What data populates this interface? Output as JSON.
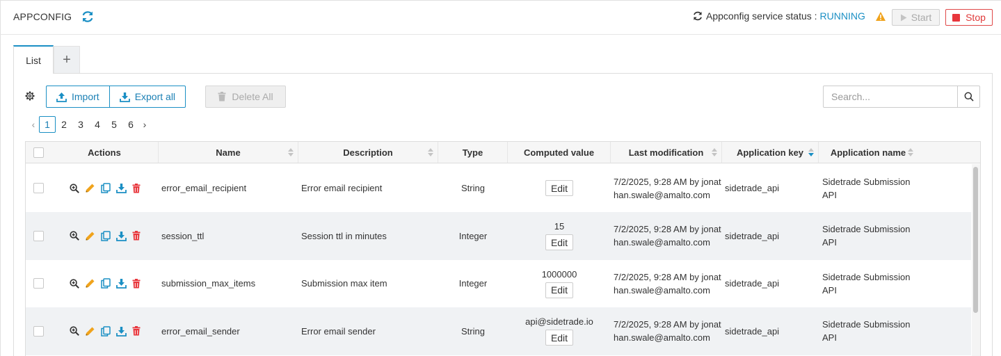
{
  "header": {
    "title": "APPCONFIG",
    "status_label": "Appconfig service status :",
    "status_value": "RUNNING",
    "start_label": "Start",
    "stop_label": "Stop"
  },
  "tabs": {
    "list_label": "List",
    "add_label": "+"
  },
  "toolbar": {
    "import_label": "Import",
    "export_label": "Export all",
    "delete_all_label": "Delete All",
    "search_placeholder": "Search..."
  },
  "pagination": {
    "prev": "‹",
    "next": "›",
    "pages": [
      "1",
      "2",
      "3",
      "4",
      "5",
      "6"
    ],
    "current": "1"
  },
  "table": {
    "columns": {
      "actions": "Actions",
      "name": "Name",
      "description": "Description",
      "type": "Type",
      "computed_value": "Computed value",
      "last_modification": "Last modification",
      "application_key": "Application key",
      "application_name": "Application name"
    },
    "rows": [
      {
        "name": "error_email_recipient",
        "description": "Error email recipient",
        "type": "String",
        "computed_value": "",
        "edit_label": "Edit",
        "last_modification": "7/2/2025, 9:28 AM by jonathan.swale@amalto.com",
        "application_key": "sidetrade_api",
        "application_name": "Sidetrade Submission API"
      },
      {
        "name": "session_ttl",
        "description": "Session ttl in minutes",
        "type": "Integer",
        "computed_value": "15",
        "edit_label": "Edit",
        "last_modification": "7/2/2025, 9:28 AM by jonathan.swale@amalto.com",
        "application_key": "sidetrade_api",
        "application_name": "Sidetrade Submission API"
      },
      {
        "name": "submission_max_items",
        "description": "Submission max item",
        "type": "Integer",
        "computed_value": "1000000",
        "edit_label": "Edit",
        "last_modification": "7/2/2025, 9:28 AM by jonathan.swale@amalto.com",
        "application_key": "sidetrade_api",
        "application_name": "Sidetrade Submission API"
      },
      {
        "name": "error_email_sender",
        "description": "Error email sender",
        "type": "String",
        "computed_value": "api@sidetrade.io",
        "edit_label": "Edit",
        "last_modification": "7/2/2025, 9:28 AM by jonathan.swale@amalto.com",
        "application_key": "sidetrade_api",
        "application_name": "Sidetrade Submission API"
      }
    ]
  },
  "colors": {
    "accent": "#1a8fc4",
    "danger": "#e8363c",
    "warning": "#f0a31c",
    "edit_icon": "#f0a31c",
    "delete_icon": "#e8363c"
  }
}
